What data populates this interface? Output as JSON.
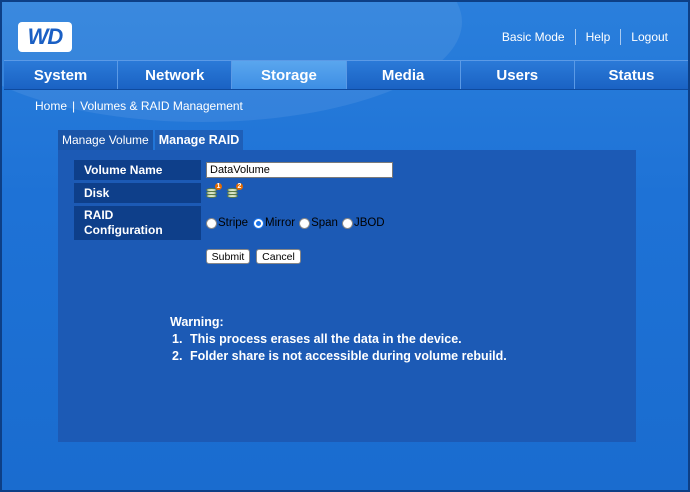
{
  "header": {
    "logo_text": "WD",
    "links": [
      {
        "label": "Basic Mode"
      },
      {
        "label": "Help"
      },
      {
        "label": "Logout"
      }
    ]
  },
  "nav": {
    "tabs": [
      {
        "label": "System",
        "active": false
      },
      {
        "label": "Network",
        "active": false
      },
      {
        "label": "Storage",
        "active": true
      },
      {
        "label": "Media",
        "active": false
      },
      {
        "label": "Users",
        "active": false
      },
      {
        "label": "Status",
        "active": false
      }
    ]
  },
  "breadcrumb": {
    "home": "Home",
    "separator": "|",
    "current": "Volumes & RAID Management"
  },
  "subtabs": [
    {
      "label": "Manage Volume",
      "active": false
    },
    {
      "label": "Manage RAID",
      "active": true
    }
  ],
  "form": {
    "volume_name_label": "Volume Name",
    "volume_name_value": "DataVolume",
    "disk_label": "Disk",
    "disks": [
      {
        "number": "1",
        "icon": "disk-icon"
      },
      {
        "number": "2",
        "icon": "disk-icon"
      }
    ],
    "raid_label_line1": "RAID",
    "raid_label_line2": "Configuration",
    "raid_options": [
      {
        "label": "Stripe",
        "selected": false
      },
      {
        "label": "Mirror",
        "selected": true
      },
      {
        "label": "Span",
        "selected": false
      },
      {
        "label": "JBOD",
        "selected": false
      }
    ],
    "submit_label": "Submit",
    "cancel_label": "Cancel"
  },
  "warning": {
    "title": "Warning:",
    "items": [
      {
        "num": "1.",
        "text": "This process erases all the data in the device."
      },
      {
        "num": "2.",
        "text": "Folder share is not accessible during volume rebuild."
      }
    ]
  },
  "colors": {
    "background": "#1e72d6",
    "panel": "#1c5ab5",
    "label_bg": "#0e3f8a",
    "active_tab": "#3d8ee4"
  }
}
